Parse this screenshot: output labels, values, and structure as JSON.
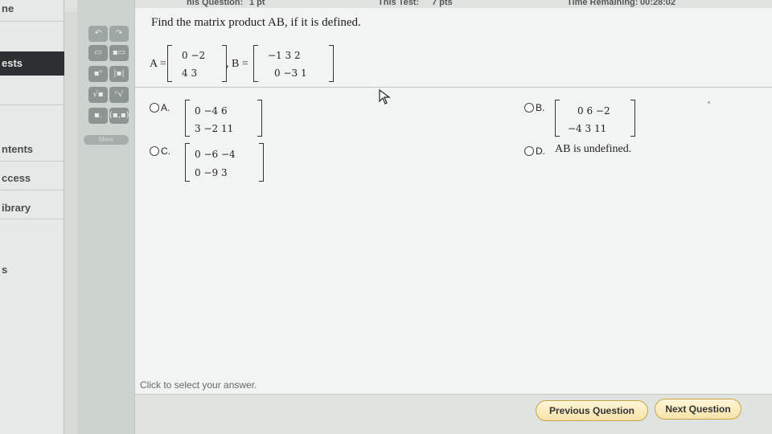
{
  "header": {
    "this_question": "his Question:",
    "question_pts": "1 pt",
    "this_test": "This Test:",
    "test_pts": "7 pts",
    "time_remaining_label": "Time Remaining:",
    "time_remaining": "00:28:02"
  },
  "sidebar": {
    "items": [
      {
        "label": "ne"
      },
      {
        "label": "ests"
      },
      {
        "label": "ntents"
      },
      {
        "label": "ccess"
      },
      {
        "label": "ibrary"
      },
      {
        "label": "s"
      }
    ]
  },
  "palette": {
    "more_label": "More",
    "tools": [
      "undo-icon",
      "redo-icon",
      "fraction-icon",
      "mixed-number-icon",
      "exponent-icon",
      "absolute-value-icon",
      "sqrt-icon",
      "nth-root-icon",
      "decimal-icon",
      "ordered-pair-icon"
    ]
  },
  "question": {
    "prompt": "Find the matrix product AB, if it is defined.",
    "matrix_a_label": "A =",
    "matrix_b_label": ", B =",
    "matrix_a": {
      "r1": "0  −2",
      "r2": "4    3"
    },
    "matrix_b": {
      "r1": "−1     3  2",
      "r2": "0  −3  1"
    }
  },
  "options": [
    {
      "letter": "A.",
      "r1": "0  −4    6",
      "r2": "3  −2  11"
    },
    {
      "letter": "B.",
      "r1": "0  6  −2",
      "r2": "−4  3    11"
    },
    {
      "letter": "C.",
      "r1": "0  −6  −4",
      "r2": "0  −9     3"
    },
    {
      "letter": "D.",
      "text": "AB is undefined."
    }
  ],
  "footer": {
    "hint": "Click to select your answer.",
    "previous_label": "Previous Question",
    "next_label": "Next Question"
  }
}
